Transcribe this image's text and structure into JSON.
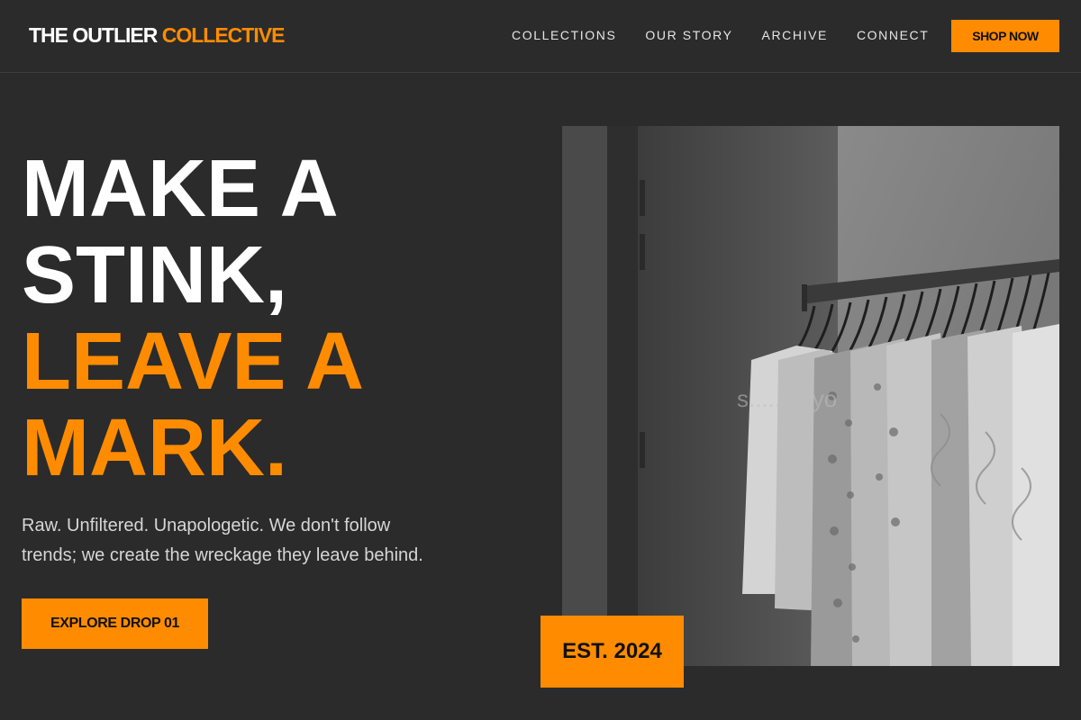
{
  "brand": {
    "name_part1": "THE OUTLIER",
    "name_part2": "COLLECTIVE"
  },
  "nav": {
    "items": [
      {
        "label": "COLLECTIONS"
      },
      {
        "label": "OUR STORY"
      },
      {
        "label": "ARCHIVE"
      },
      {
        "label": "CONNECT"
      }
    ],
    "cta_label": "SHOP NOW"
  },
  "hero": {
    "headline_lines_white": [
      "MAKE A",
      "STINK,"
    ],
    "headline_lines_orange": [
      "LEAVE A",
      "MARK."
    ],
    "tagline": "Raw. Unfiltered. Unapologetic. We don't follow trends; we create the wreckage they leave behind.",
    "cta_label": "EXPLORE DROP 01",
    "image_watermark": "s.....tokyo",
    "est_badge": "EST. 2024"
  },
  "colors": {
    "accent": "#ff8c00",
    "background": "#2b2b2b",
    "text": "#ffffff"
  }
}
